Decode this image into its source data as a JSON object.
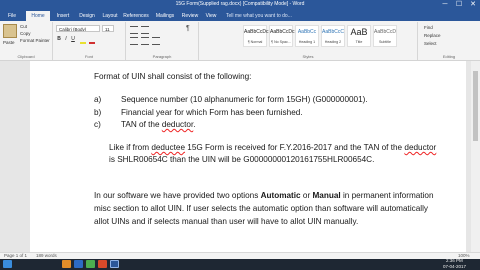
{
  "window": {
    "title": "15G Form(Supplied rag.docx) [Compatibility Mode] - Word",
    "buttons": [
      "─",
      "☐",
      "✕"
    ]
  },
  "ribbon_tabs": [
    "File",
    "Home",
    "Insert",
    "Design",
    "Layout",
    "References",
    "Mailings",
    "Review",
    "View"
  ],
  "active_tab": "Home",
  "tell_me": "Tell me what you want to do...",
  "ribbon": {
    "clipboard": {
      "paste": "Paste",
      "cut": "Cut",
      "copy": "Copy",
      "format_painter": "Format Painter",
      "label": "Clipboard"
    },
    "font": {
      "name": "Calibri (Body)",
      "size": "11",
      "label": "Font"
    },
    "paragraph": {
      "label": "Paragraph"
    },
    "styles": {
      "items": [
        {
          "preview": "AaBbCcDc",
          "name": "¶ Normal"
        },
        {
          "preview": "AaBbCcDc",
          "name": "¶ No Spac..."
        },
        {
          "preview": "AaBbCc",
          "name": "Heading 1"
        },
        {
          "preview": "AaBbCcC",
          "name": "Heading 2"
        },
        {
          "preview": "AaB",
          "name": "Title"
        },
        {
          "preview": "AaBbCcD",
          "name": "Subtitle"
        }
      ],
      "label": "Styles"
    },
    "editing": {
      "find": "Find",
      "replace": "Replace",
      "select": "Select",
      "label": "Editing"
    }
  },
  "document": {
    "heading": "Format of UIN shall consist of the following:",
    "items": [
      {
        "marker": "a)",
        "text": "Sequence number (10 alphanumeric for form 15GH) (G000000001)."
      },
      {
        "marker": "b)",
        "text": "Financial year for which Form has been furnished."
      },
      {
        "marker": "c)",
        "text_before": "TAN of the ",
        "text_underlined": "deductor",
        "text_after": "."
      }
    ],
    "example_line1_a": "Like if from ",
    "example_line1_b": "deductee",
    "example_line1_c": " 15G Form is received for F.Y.2016-2017 and the TAN of the ",
    "example_line1_d": "deductor",
    "example_line2": "is SHLR00654C than the UIN will be G00000000120161755HLR00654C.",
    "para2_line1_a": "In our software we have provided two options ",
    "para2_line1_b": "Automatic",
    "para2_line1_c": " or ",
    "para2_line1_d": "Manual",
    "para2_line1_e": " in permanent information",
    "para2_line2": "misc section to allot UIN. If user selects the automatic option than software will automatically",
    "para2_line3": "allot UINs and if selects manual than user will have to allot UIN manually."
  },
  "status_bar": {
    "page": "Page 1 of 1",
    "words": "189 words",
    "zoom": "100%"
  },
  "taskbar": {
    "time": "2:36 PM",
    "date": "07-04-2017"
  }
}
